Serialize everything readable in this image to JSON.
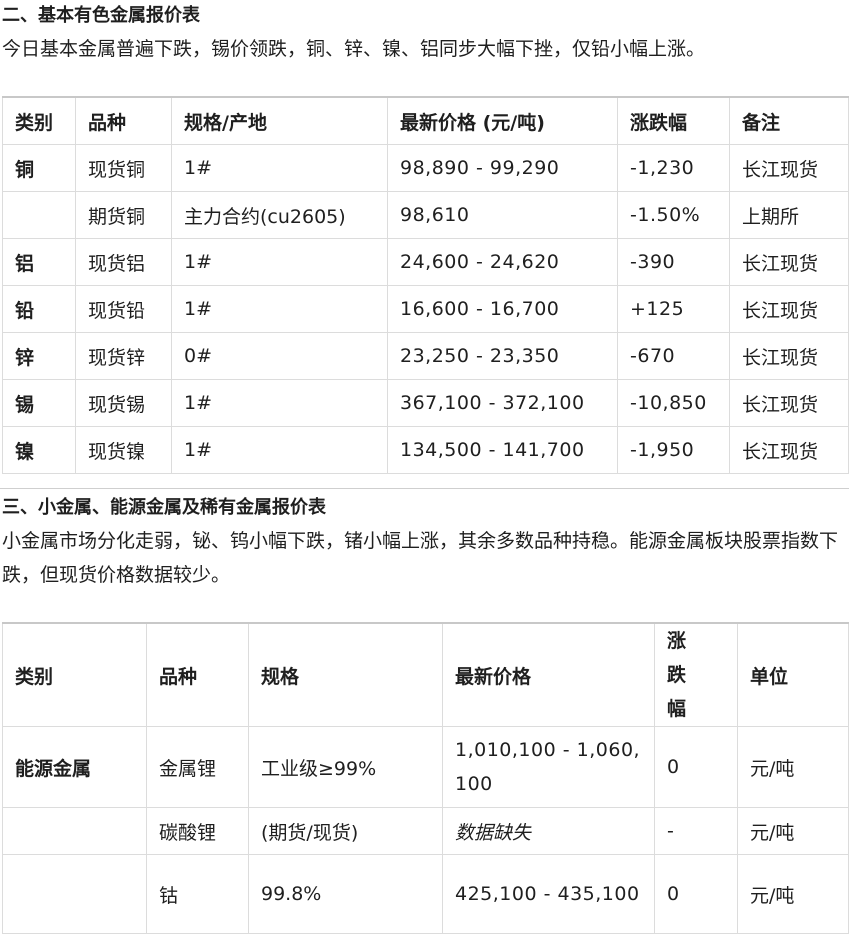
{
  "section2": {
    "title": "二、基本有色金属报价表",
    "summary": "今日基本金属普遍下跌，锡价领跌，铜、锌、镍、铝同步大幅下挫，仅铅小幅上涨。",
    "headers": [
      "类别",
      "品种",
      "规格/产地",
      "最新价格 (元/吨)",
      "涨跌幅",
      "备注"
    ],
    "rows": [
      [
        "铜",
        "现货铜",
        "1#",
        "98,890 - 99,290",
        "-1,230",
        "长江现货"
      ],
      [
        "",
        "期货铜",
        "主力合约(cu2605)",
        "98,610",
        "-1.50%",
        "上期所"
      ],
      [
        "铝",
        "现货铝",
        "1#",
        "24,600 - 24,620",
        "-390",
        "长江现货"
      ],
      [
        "铅",
        "现货铅",
        "1#",
        "16,600 - 16,700",
        "+125",
        "长江现货"
      ],
      [
        "锌",
        "现货锌",
        "0#",
        "23,250 - 23,350",
        "-670",
        "长江现货"
      ],
      [
        "锡",
        "现货锡",
        "1#",
        "367,100 - 372,100",
        "-10,850",
        "长江现货"
      ],
      [
        "镍",
        "现货镍",
        "1#",
        "134,500 - 141,700",
        "-1,950",
        "长江现货"
      ]
    ]
  },
  "section3": {
    "title": "三、小金属、能源金属及稀有金属报价表",
    "summary": "小金属市场分化走弱，铋、钨小幅下跌，锗小幅上涨，其余多数品种持稳。能源金属板块股票指数下跌，但现货价格数据较少。",
    "headers": [
      "类别",
      "品种",
      "规格",
      "最新价格",
      "涨跌幅",
      "单位"
    ],
    "rows": [
      [
        "能源金属",
        "金属锂",
        "工业级≥99%",
        "1,010,100 - 1,060,100",
        "0",
        "元/吨"
      ],
      [
        "",
        "碳酸锂",
        "(期货/现货)",
        "数据缺失",
        "-",
        "元/吨"
      ],
      [
        "",
        "钴",
        "99.8%",
        "425,100 - 435,100",
        "0",
        "元/吨"
      ]
    ]
  }
}
